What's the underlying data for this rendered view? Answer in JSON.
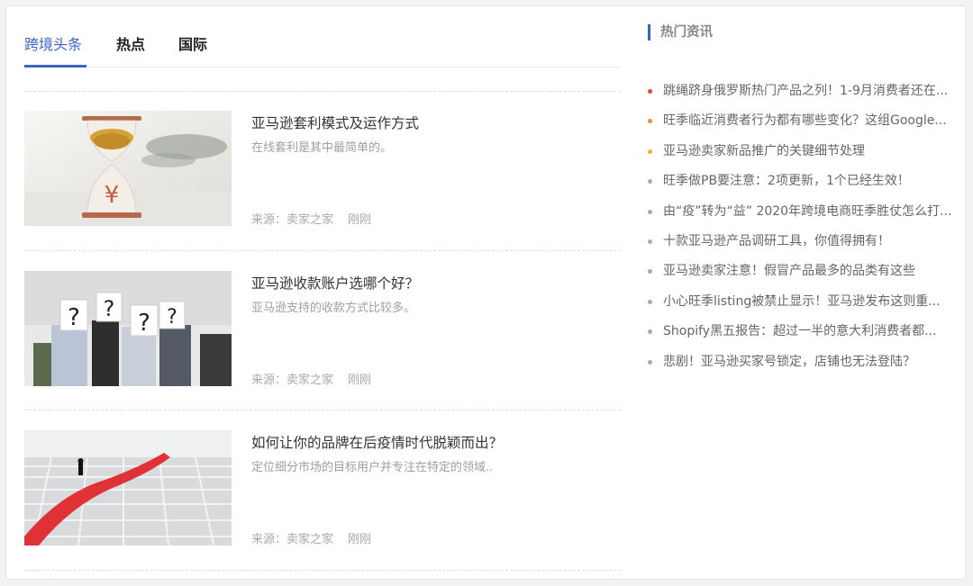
{
  "tabs": [
    {
      "label": "跨境头条",
      "active": true
    },
    {
      "label": "热点",
      "active": false
    },
    {
      "label": "国际",
      "active": false
    }
  ],
  "articles": [
    {
      "title": "亚马逊套利模式及运作方式",
      "desc": "在线套利是其中最简单的。",
      "source": "来源：卖家之家",
      "time": "刚刚",
      "thumb_icon": "hourglass-coins-image"
    },
    {
      "title": "亚马逊收款账户选哪个好？",
      "desc": "亚马逊支持的收款方式比较多。",
      "source": "来源：卖家之家",
      "time": "刚刚",
      "thumb_icon": "question-mark-people-image"
    },
    {
      "title": "如何让你的品牌在后疫情时代脱颖而出？",
      "desc": "定位细分市场的目标用户并专注在特定的领域..",
      "source": "来源：卖家之家",
      "time": "刚刚",
      "thumb_icon": "maze-red-path-image"
    }
  ],
  "sidebar": {
    "title": "热门资讯",
    "accent": "#3a63c9",
    "items": [
      {
        "text": "跳绳跻身俄罗斯热门产品之列！1-9月消费者还在...",
        "dot": "#e04a3a"
      },
      {
        "text": "旺季临近消费者行为都有哪些变化？这组Google...",
        "dot": "#ef8a3c"
      },
      {
        "text": "亚马逊卖家新品推广的关键细节处理",
        "dot": "#f0b03c"
      },
      {
        "text": "旺季做PB要注意：2项更新，1个已经生效！",
        "dot": "#aaaaaa"
      },
      {
        "text": "由“疫”转为“益” 2020年跨境电商旺季胜仗怎么打...",
        "dot": "#aaaaaa"
      },
      {
        "text": "十款亚马逊产品调研工具，你值得拥有！",
        "dot": "#aaaaaa"
      },
      {
        "text": "亚马逊卖家注意！假冒产品最多的品类有这些",
        "dot": "#aaaaaa"
      },
      {
        "text": "小心旺季listing被禁止显示！亚马逊发布这则重...",
        "dot": "#aaaaaa"
      },
      {
        "text": "Shopify黑五报告：超过一半的意大利消费者都...",
        "dot": "#aaaaaa"
      },
      {
        "text": "悲剧！亚马逊买家号锁定，店铺也无法登陆？",
        "dot": "#aaaaaa"
      }
    ]
  }
}
